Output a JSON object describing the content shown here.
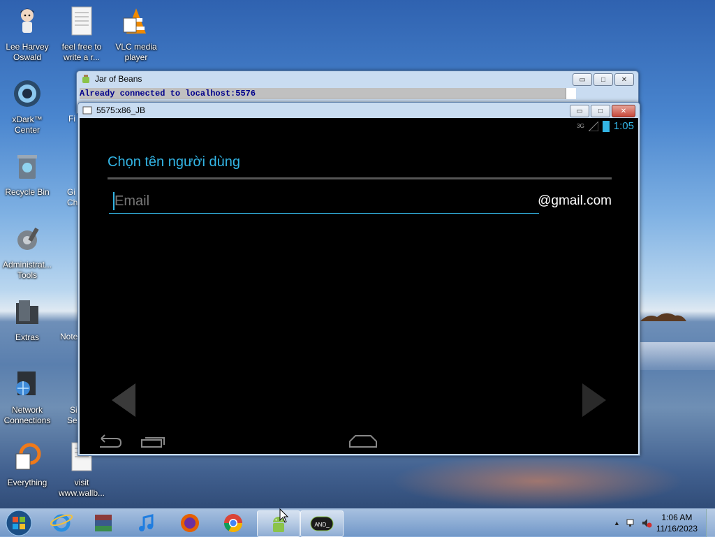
{
  "desktop_icons": [
    {
      "label": "Lee Harvey Oswald",
      "icon": "character-icon"
    },
    {
      "label": "feel free to write a r...",
      "icon": "text-file-icon"
    },
    {
      "label": "VLC media player",
      "icon": "vlc-icon"
    },
    {
      "label": "xDark™ Center",
      "icon": "xdark-icon"
    },
    {
      "label": "Recycle Bin",
      "icon": "recycle-bin-icon"
    },
    {
      "label": "Administrat... Tools",
      "icon": "admin-tools-icon"
    },
    {
      "label": "Extras",
      "icon": "folder-icon"
    },
    {
      "label": "Network Connections",
      "icon": "network-icon"
    },
    {
      "label": "Everything",
      "icon": "everything-icon"
    },
    {
      "label": "visit www.wallb...",
      "icon": "text-file-icon"
    }
  ],
  "partial_labels": [
    "Fi",
    "Gi",
    "Ch",
    "Note",
    "Si",
    "Se"
  ],
  "jar_window": {
    "title": "Jar of Beans",
    "console_text": "Already connected to localhost:5576"
  },
  "emulator_window": {
    "title": "5575:x86_JB",
    "status_signal": "3G",
    "status_time": "1:05",
    "heading": "Chọn tên người dùng",
    "email_placeholder": "Email",
    "email_domain": "@gmail.com"
  },
  "taskbar": {
    "items": [
      "internet-explorer-icon",
      "winrar-icon",
      "itunes-icon",
      "firefox-icon",
      "chrome-icon",
      "android-icon",
      "android-sdk-icon"
    ],
    "clock_time": "1:06 AM",
    "clock_date": "11/16/2023"
  },
  "colors": {
    "accent": "#33b5e5"
  }
}
